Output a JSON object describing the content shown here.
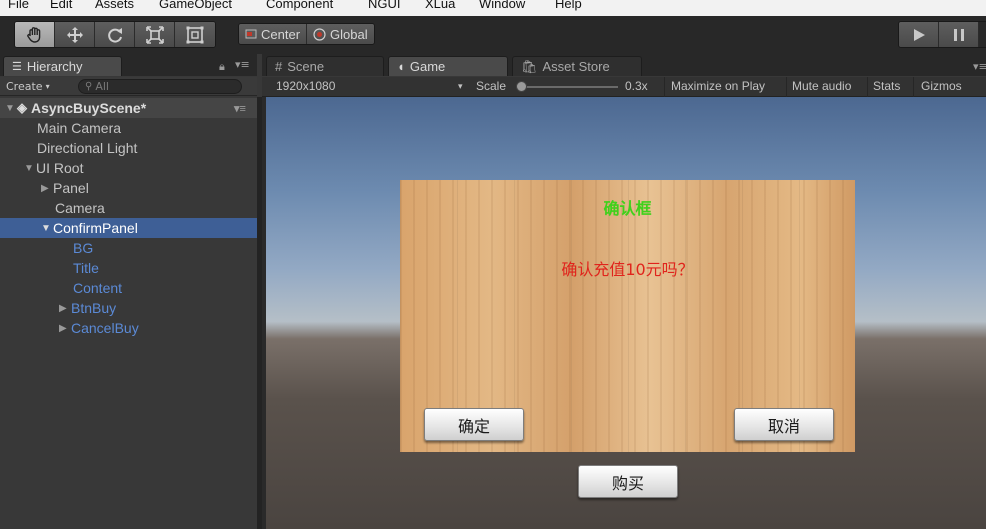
{
  "menu": [
    "File",
    "Edit",
    "Assets",
    "GameObject",
    "Component",
    "NGUI",
    "XLua",
    "Window",
    "Help"
  ],
  "toolbar": {
    "pivot_label": "Center",
    "space_label": "Global"
  },
  "tabs": {
    "hierarchy": "Hierarchy",
    "scene": "Scene",
    "game": "Game",
    "asset_store": "Asset Store"
  },
  "hierarchy": {
    "create_label": "Create",
    "search_placeholder": "All",
    "scene_name": "AsyncBuyScene*",
    "items": [
      {
        "label": "Main Camera"
      },
      {
        "label": "Directional Light"
      },
      {
        "label": "UI Root"
      },
      {
        "label": "Panel"
      },
      {
        "label": "Camera"
      },
      {
        "label": "ConfirmPanel"
      },
      {
        "label": "BG"
      },
      {
        "label": "Title"
      },
      {
        "label": "Content"
      },
      {
        "label": "BtnBuy"
      },
      {
        "label": "CancelBuy"
      }
    ]
  },
  "gameview": {
    "resolution": "1920x1080",
    "scale_label": "Scale",
    "scale_value": "0.3x",
    "maximize": "Maximize on Play",
    "mute": "Mute audio",
    "stats": "Stats",
    "gizmos": "Gizmos"
  },
  "dialog": {
    "title": "确认框",
    "content": "确认充值10元吗？",
    "confirm": "确定",
    "cancel": "取消",
    "buy": "购买"
  },
  "colors": {
    "selection": "#3e5f96",
    "prefab_blue": "#5b8ad6",
    "title_green": "#3fd11b",
    "content_red": "#e0241c"
  }
}
